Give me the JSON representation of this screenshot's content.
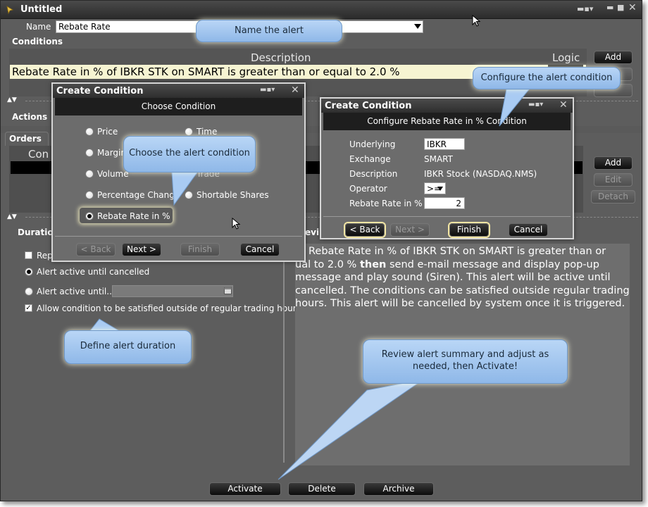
{
  "window": {
    "title": "Untitled"
  },
  "name_row": {
    "label": "Name",
    "value": "Rebate Rate"
  },
  "conditions": {
    "label": "Conditions",
    "col_description": "Description",
    "col_logic": "Logic",
    "add_label": "Add",
    "row_text": "Rebate Rate in % of IBKR STK on SMART is greater than or equal to 2.0 %"
  },
  "actions": {
    "label": "Actions"
  },
  "orders": {
    "tab_label": "Orders",
    "col_partial": "Con",
    "add_label": "Add",
    "edit_label": "Edit",
    "detach_label": "Detach"
  },
  "duration": {
    "label": "Duration",
    "repeat_label": "Rep",
    "active_until_cancelled": "Alert active until cancelled",
    "active_until": "Alert active until...",
    "allow_outside": "Allow condition to be satisfied outside of regular trading hours"
  },
  "review": {
    "label_partial": "evi",
    "summary_prefix": "Rebate Rate in % of IBKR STK on SMART is greater than or",
    "summary_line2_a": "ual to 2.0 % ",
    "summary_then": "then",
    "summary_line2_b": " send e-mail message and display pop-up",
    "summary_line3": "message and play sound (Siren). This alert will be active until",
    "summary_line4": "cancelled. The conditions can be satisfied outside regular trading",
    "summary_line5": "hours. This alert will be cancelled by system once it is triggered."
  },
  "bottom_buttons": {
    "activate": "Activate",
    "delete": "Delete",
    "archive": "Archive"
  },
  "choose_dialog": {
    "title": "Create Condition",
    "subtitle": "Choose Condition",
    "options": {
      "price": "Price",
      "time": "Time",
      "margin": "Margin",
      "volume": "Volume",
      "trade": "Trade",
      "pct_change": "Percentage Change",
      "shortable": "Shortable Shares",
      "rebate": "Rebate Rate in %"
    },
    "back": "< Back",
    "next": "Next >",
    "finish": "Finish",
    "cancel": "Cancel"
  },
  "configure_dialog": {
    "title": "Create Condition",
    "subtitle": "Configure Rebate Rate in % Condition",
    "underlying_label": "Underlying",
    "underlying_value": "IBKR",
    "exchange_label": "Exchange",
    "exchange_value": "SMART",
    "description_label": "Description",
    "description_value": "IBKR Stock (NASDAQ.NMS)",
    "operator_label": "Operator",
    "operator_value": ">=",
    "rate_label": "Rebate Rate in %",
    "rate_value": "2",
    "back": "< Back",
    "next": "Next >",
    "finish": "Finish",
    "cancel": "Cancel"
  },
  "callouts": {
    "name": "Name the alert",
    "configure": "Configure the alert condition",
    "choose": "Choose the alert condition",
    "duration": "Define alert duration",
    "review_line1": "Review alert summary and adjust as",
    "review_line2": "needed, then Activate!"
  },
  "colors": {
    "condition_row_bg": "#f6f4d2",
    "callout_blue": "#a9cbf3",
    "window_bg": "#5d5d5d"
  }
}
